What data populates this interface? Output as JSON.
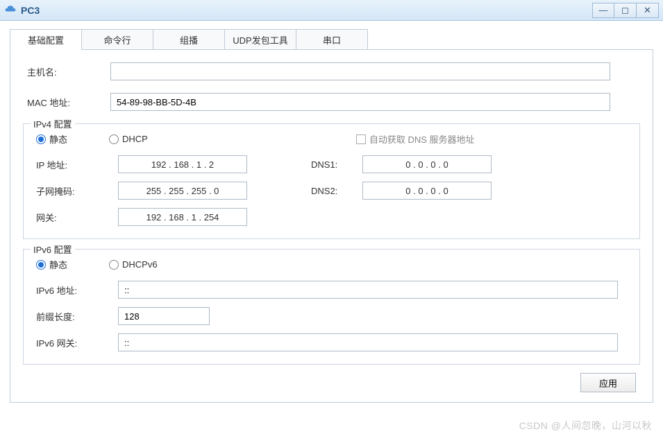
{
  "window": {
    "title": "PC3"
  },
  "tabs": [
    "基础配置",
    "命令行",
    "组播",
    "UDP发包工具",
    "串口"
  ],
  "basic": {
    "hostname_label": "主机名:",
    "hostname_value": "",
    "mac_label": "MAC 地址:",
    "mac_value": "54-89-98-BB-5D-4B"
  },
  "ipv4": {
    "legend": "IPv4 配置",
    "static_label": "静态",
    "dhcp_label": "DHCP",
    "auto_dns_label": "自动获取 DNS 服务器地址",
    "ip_label": "IP 地址:",
    "ip_value": "192  .  168  .   1   .   2",
    "mask_label": "子网掩码:",
    "mask_value": "255  .  255  .  255  .   0",
    "gw_label": "网关:",
    "gw_value": "192  .  168  .   1   .  254",
    "dns1_label": "DNS1:",
    "dns1_value": "0   .   0   .   0   .   0",
    "dns2_label": "DNS2:",
    "dns2_value": "0   .   0   .   0   .   0"
  },
  "ipv6": {
    "legend": "IPv6 配置",
    "static_label": "静态",
    "dhcp_label": "DHCPv6",
    "addr_label": "IPv6 地址:",
    "addr_value": "::",
    "prefix_label": "前缀长度:",
    "prefix_value": "128",
    "gw_label": "IPv6 网关:",
    "gw_value": "::"
  },
  "apply_label": "应用",
  "watermark": "CSDN @人间忽晚，山河以秋"
}
